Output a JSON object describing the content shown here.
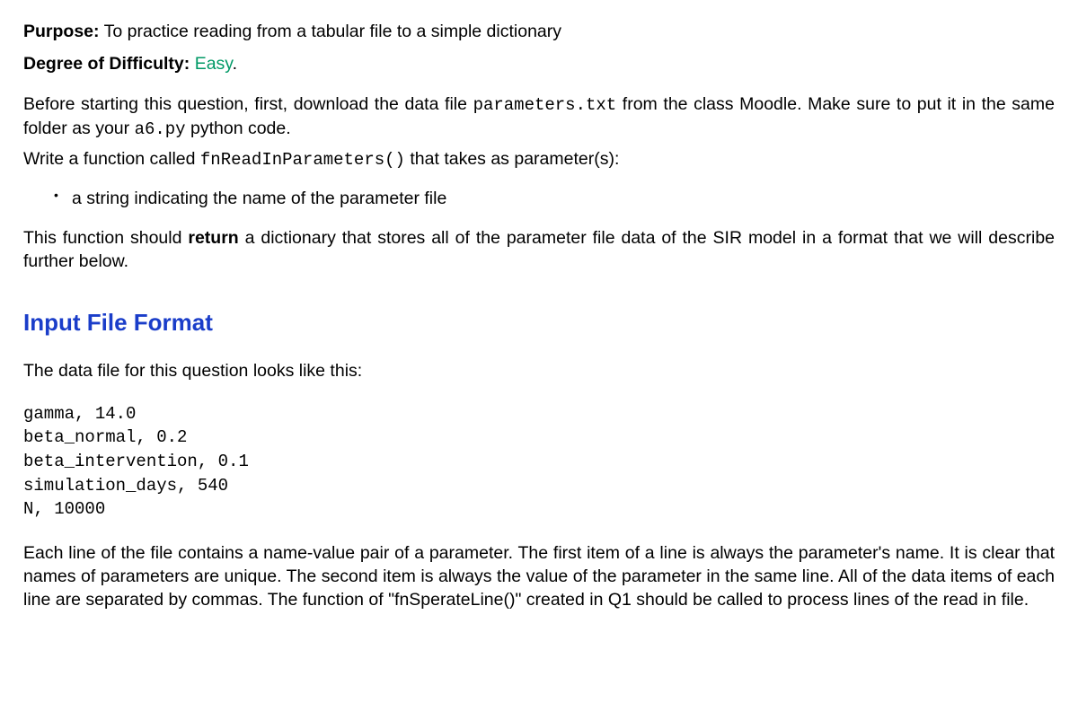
{
  "purpose": {
    "label": "Purpose:",
    "text": "To practice reading from a tabular file to a simple dictionary"
  },
  "difficulty": {
    "label": "Degree of Difficulty:",
    "value": "Easy",
    "period": "."
  },
  "intro": {
    "part1": "Before starting this question, first, download the data file ",
    "code1": "parameters.txt",
    "part2": " from the class Moodle.  Make sure to put it in the same folder as your ",
    "code2": "a6.py",
    "part3": " python code."
  },
  "write_fn": {
    "part1": "Write a function called ",
    "code1": "fnReadInParameters()",
    "part2": " that takes as parameter(s):"
  },
  "bullet": {
    "item1": "a string indicating the name of the parameter file"
  },
  "return_desc": {
    "part1": "This function should ",
    "bold": "return",
    "part2": " a dictionary that stores all of the parameter file data of the SIR model in a format that we will describe further below."
  },
  "section": {
    "heading": "Input File Format"
  },
  "datafile_intro": "The data file for this question looks like this:",
  "codeblock": "gamma, 14.0\nbeta_normal, 0.2\nbeta_intervention, 0.1\nsimulation_days, 540\nN, 10000",
  "explanation": "Each line of the file contains a name-value pair of a parameter. The first item of a line is always the parameter's name. It is clear that names of parameters are unique. The second item is always the value of the parameter in the same line. All of the data items of each line are separated by commas. The function of \"fnSperateLine()\" created in Q1 should be called to process lines of the read in file."
}
